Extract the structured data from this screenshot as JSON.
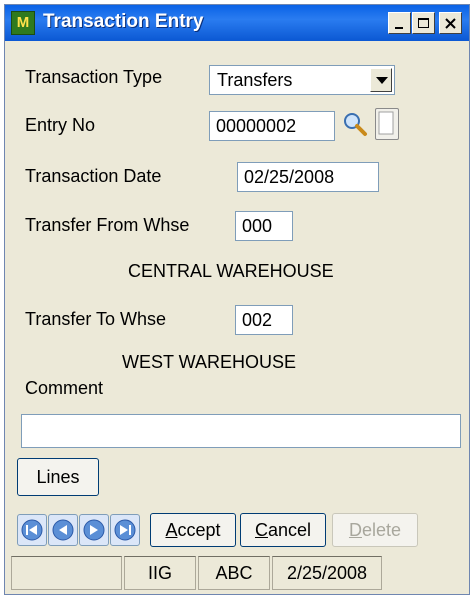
{
  "window": {
    "title": "Transaction Entry",
    "app_icon": "sage-mas90-icon"
  },
  "form": {
    "transaction_type_label": "Transaction Type",
    "transaction_type_value": "Transfers",
    "entry_no_label": "Entry No",
    "entry_no_value": "00000002",
    "transaction_date_label": "Transaction Date",
    "transaction_date_value": "02/25/2008",
    "from_whse_label": "Transfer From Whse",
    "from_whse_value": "000",
    "from_whse_name": "CENTRAL WAREHOUSE",
    "to_whse_label": "Transfer To Whse",
    "to_whse_value": "002",
    "to_whse_name": "WEST WAREHOUSE",
    "comment_label": "Comment",
    "comment_value": ""
  },
  "buttons": {
    "lines": "Lines",
    "accept_first": "A",
    "accept_rest": "ccept",
    "cancel_first": "C",
    "cancel_rest": "ancel",
    "delete_first": "D",
    "delete_rest": "elete"
  },
  "status": {
    "cell1": "",
    "cell2": "IIG",
    "cell3": "ABC",
    "cell4": "2/25/2008"
  },
  "colors": {
    "title_bar": "#0a62e6",
    "window_bg": "#ece9d8"
  }
}
